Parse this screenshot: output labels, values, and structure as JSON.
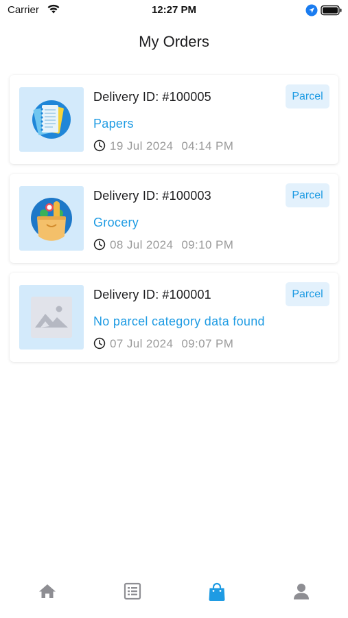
{
  "status_bar": {
    "carrier": "Carrier",
    "time": "12:27 PM"
  },
  "page": {
    "title": "My Orders"
  },
  "orders": [
    {
      "delivery_label": "Delivery ID:",
      "delivery_id": "#100005",
      "category": "Papers",
      "date": "19 Jul 2024",
      "time": "04:14 PM",
      "tag": "Parcel",
      "icon": "papers-category-icon"
    },
    {
      "delivery_label": "Delivery ID:",
      "delivery_id": "#100003",
      "category": "Grocery",
      "date": "08 Jul 2024",
      "time": "09:10 PM",
      "tag": "Parcel",
      "icon": "grocery-category-icon"
    },
    {
      "delivery_label": "Delivery ID:",
      "delivery_id": "#100001",
      "category": "No parcel category data found",
      "date": "07 Jul 2024",
      "time": "09:07 PM",
      "tag": "Parcel",
      "icon": "image-placeholder-icon"
    }
  ],
  "tab_bar": {
    "tabs": [
      {
        "icon": "home-icon",
        "active": false
      },
      {
        "icon": "list-icon",
        "active": false
      },
      {
        "icon": "shopping-bag-icon",
        "active": true
      },
      {
        "icon": "person-icon",
        "active": false
      }
    ]
  },
  "colors": {
    "accent": "#1e9be3",
    "tag_background": "#e3f1fc",
    "thumb_background": "#d3eafb",
    "inactive_tab": "#8e8e93",
    "muted_text": "#9a9a9a"
  }
}
